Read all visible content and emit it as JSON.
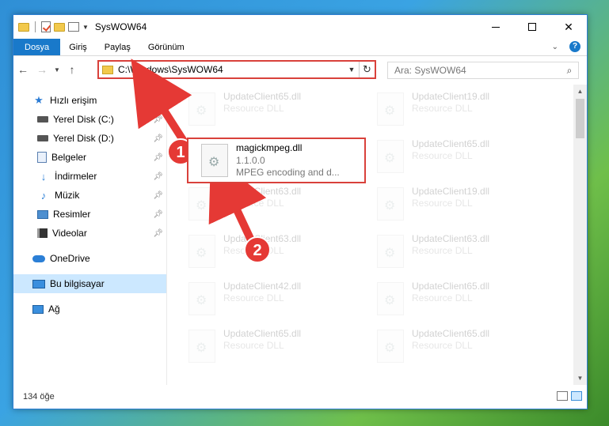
{
  "window": {
    "title": "SysWOW64",
    "qa_icons": [
      "folder-icon",
      "checklist-icon",
      "folder-icon",
      "properties-icon",
      "dropdown-arrow-icon"
    ]
  },
  "ribbon": {
    "tabs": [
      {
        "label": "Dosya",
        "active": true
      },
      {
        "label": "Giriş",
        "active": false
      },
      {
        "label": "Paylaş",
        "active": false
      },
      {
        "label": "Görünüm",
        "active": false
      }
    ]
  },
  "navbar": {
    "address": "C:\\Windows\\SysWOW64",
    "search_placeholder": "Ara: SysWOW64"
  },
  "sidebar": {
    "quick_access": "Hızlı erişim",
    "items": [
      {
        "label": "Yerel Disk (C:)",
        "icon": "drive-icon"
      },
      {
        "label": "Yerel Disk (D:)",
        "icon": "drive-icon"
      },
      {
        "label": "Belgeler",
        "icon": "documents-icon"
      },
      {
        "label": "İndirmeler",
        "icon": "downloads-icon"
      },
      {
        "label": "Müzik",
        "icon": "music-icon"
      },
      {
        "label": "Resimler",
        "icon": "pictures-icon"
      },
      {
        "label": "Videolar",
        "icon": "videos-icon"
      }
    ],
    "onedrive": "OneDrive",
    "this_pc": "Bu bilgisayar",
    "network": "Ağ"
  },
  "files": {
    "highlighted": {
      "name": "magickmpeg.dll",
      "version": "1.1.0.0",
      "description": "MPEG encoding and d..."
    },
    "ghost_left": [
      {
        "name": "UpdateClient65.dll",
        "type": "Resource DLL"
      },
      {
        "name": "UpdateClient63.dll",
        "type": "Resource DLL"
      },
      {
        "name": "UpdateClient63.dll",
        "type": "Resource DLL"
      },
      {
        "name": "UpdateClient42.dll",
        "type": "Resource DLL"
      },
      {
        "name": "UpdateClient65.dll",
        "type": "Resource DLL"
      }
    ],
    "ghost_right": [
      {
        "name": "UpdateClient19.dll",
        "type": "Resource DLL"
      },
      {
        "name": "UpdateClient65.dll",
        "type": "Resource DLL"
      },
      {
        "name": "UpdateClient19.dll",
        "type": "Resource DLL"
      },
      {
        "name": "UpdateClient63.dll",
        "type": "Resource DLL"
      },
      {
        "name": "UpdateClient65.dll",
        "type": "Resource DLL"
      },
      {
        "name": "UpdateClient65.dll",
        "type": "Resource DLL"
      }
    ]
  },
  "status": {
    "count": "134 öğe"
  },
  "annotations": {
    "step1": "1",
    "step2": "2",
    "color": "#e53935"
  }
}
